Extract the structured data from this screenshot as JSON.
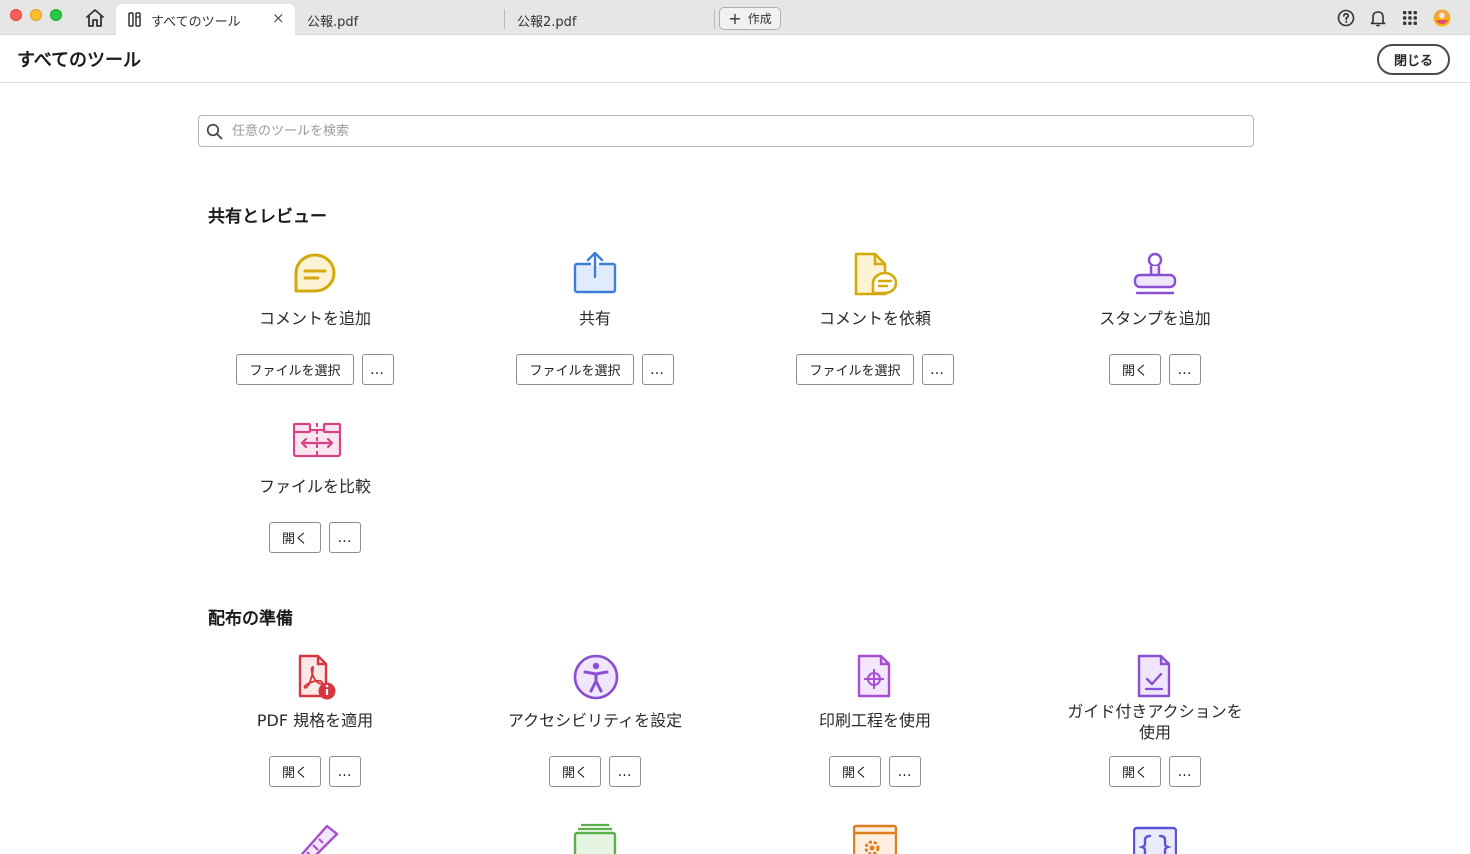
{
  "window": {
    "tabs": [
      {
        "label": "すべてのツール",
        "active": true,
        "icon": "tools-icon"
      },
      {
        "label": "公報.pdf",
        "active": false
      },
      {
        "label": "公報2.pdf",
        "active": false
      }
    ],
    "new_button_label": "作成",
    "right_icons": [
      "help-icon",
      "bell-icon",
      "apps-grid-icon",
      "avatar"
    ]
  },
  "header": {
    "title": "すべてのツール",
    "close_label": "閉じる"
  },
  "search": {
    "placeholder": "任意のツールを検索",
    "value": ""
  },
  "sections": [
    {
      "title": "共有とレビュー",
      "tools": [
        {
          "label": "コメントを追加",
          "icon": "comment-icon",
          "color": "#d3a90b",
          "primary": "ファイルを選択",
          "more": "…"
        },
        {
          "label": "共有",
          "icon": "share-icon",
          "color": "#3d7fd8",
          "primary": "ファイルを選択",
          "more": "…"
        },
        {
          "label": "コメントを依頼",
          "icon": "request-comment-icon",
          "color": "#d3a90b",
          "primary": "ファイルを選択",
          "more": "…"
        },
        {
          "label": "スタンプを追加",
          "icon": "stamp-icon",
          "color": "#8b4fd4",
          "primary": "開く",
          "more": "…"
        },
        {
          "label": "ファイルを比較",
          "icon": "compare-files-icon",
          "color": "#d64387",
          "primary": "開く",
          "more": "…"
        }
      ]
    },
    {
      "title": "配布の準備",
      "tools": [
        {
          "label": "PDF 規格を適用",
          "icon": "pdf-standards-icon",
          "color": "#d7373f",
          "primary": "開く",
          "more": "…"
        },
        {
          "label": "アクセシビリティを設定",
          "icon": "accessibility-icon",
          "color": "#8b4fd4",
          "primary": "開く",
          "more": "…"
        },
        {
          "label": "印刷工程を使用",
          "icon": "print-production-icon",
          "color": "#a64fd0",
          "primary": "開く",
          "more": "…"
        },
        {
          "label": "ガイド付きアクションを使用",
          "label_line1": "ガイド付きアクションを",
          "label_line2": "使用",
          "icon": "guided-action-icon",
          "color": "#8b4fd4",
          "primary": "開く",
          "more": "…"
        }
      ]
    }
  ],
  "partial_row_icons": [
    "measure-icon",
    "layers-icon",
    "settings-window-icon",
    "javascript-icon"
  ]
}
